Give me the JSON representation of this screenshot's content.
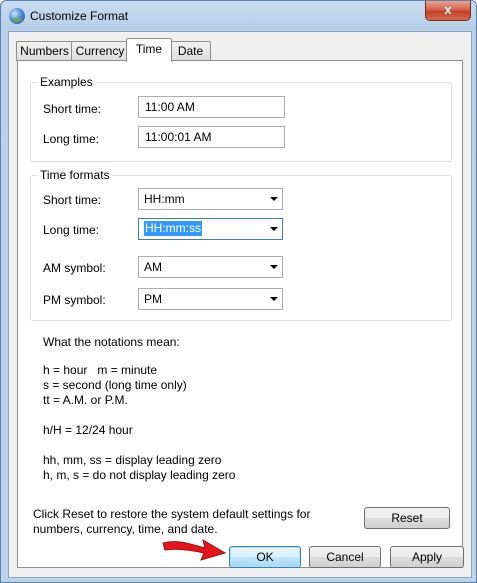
{
  "window": {
    "title": "Customize Format",
    "close_label": "x"
  },
  "tabs": [
    {
      "label": "Numbers",
      "active": false
    },
    {
      "label": "Currency",
      "active": false
    },
    {
      "label": "Time",
      "active": true
    },
    {
      "label": "Date",
      "active": false
    }
  ],
  "examples": {
    "title": "Examples",
    "short_label": "Short time:",
    "short_value": "11:00 AM",
    "long_label": "Long time:",
    "long_value": "11:00:01 AM"
  },
  "formats": {
    "title": "Time formats",
    "short_label": "Short time:",
    "short_value": "HH:mm",
    "long_label": "Long time:",
    "long_value": "HH:mm:ss",
    "am_label": "AM symbol:",
    "am_value": "AM",
    "pm_label": "PM symbol:",
    "pm_value": "PM"
  },
  "notes": {
    "heading": "What the notations mean:",
    "line1": "h = hour   m = minute",
    "line2": "s = second (long time only)",
    "line3": "tt = A.M. or P.M.",
    "line4": "h/H = 12/24 hour",
    "line5": "hh, mm, ss = display leading zero",
    "line6": "h, m, s = do not display leading zero"
  },
  "reset": {
    "text_line1": "Click Reset to restore the system default settings for",
    "text_line2": "numbers, currency, time, and date.",
    "button": "Reset"
  },
  "buttons": {
    "ok": "OK",
    "cancel": "Cancel",
    "apply": "Apply"
  },
  "colors": {
    "arrow": "#e8141b",
    "selection": "#3399ff",
    "title_bar": "#b9d1ea"
  }
}
